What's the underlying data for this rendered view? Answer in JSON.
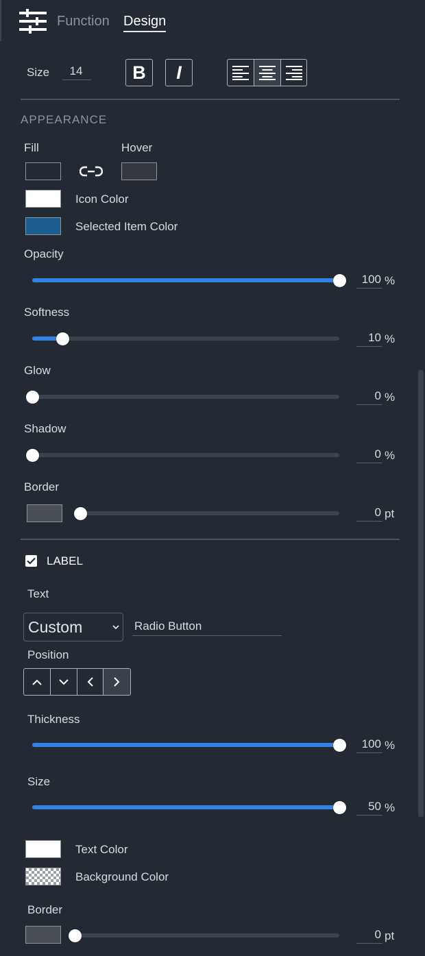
{
  "tabs": {
    "function_label": "Function",
    "design_label": "Design",
    "active": "Design"
  },
  "font_row": {
    "size_label": "Size",
    "size_value": "14",
    "bold_label": "B",
    "italic_label": "I",
    "align_selected": "center"
  },
  "appearance": {
    "title": "APPEARANCE",
    "fill_label": "Fill",
    "hover_label": "Hover",
    "fill_color": "#232a33",
    "hover_color": "#35393f",
    "icon_color_label": "Icon Color",
    "icon_color": "#ffffff",
    "selected_item_color_label": "Selected Item Color",
    "selected_item_color": "#1c5d8f",
    "sliders": [
      {
        "label": "Opacity",
        "value": 100,
        "display": "100",
        "unit": "%"
      },
      {
        "label": "Softness",
        "value": 10,
        "display": "10",
        "unit": "%"
      },
      {
        "label": "Glow",
        "value": 0,
        "display": "0",
        "unit": "%"
      },
      {
        "label": "Shadow",
        "value": 0,
        "display": "0",
        "unit": "%"
      },
      {
        "label": "Border",
        "value": 0,
        "display": "0",
        "unit": "pt",
        "color": "#4a4e55"
      }
    ]
  },
  "label_section": {
    "title": "LABEL",
    "checked": true,
    "text_label": "Text",
    "text_mode": "Custom",
    "text_value": "Radio Button",
    "position_label": "Position",
    "position_selected": "right",
    "sliders": [
      {
        "label": "Thickness",
        "value": 100,
        "display": "100",
        "unit": "%"
      },
      {
        "label": "Size",
        "value": 100,
        "display": "50",
        "unit": "%"
      }
    ],
    "text_color_label": "Text Color",
    "text_color": "#ffffff",
    "background_color_label": "Background Color",
    "background_color": "transparent",
    "border": {
      "label": "Border",
      "value": 0,
      "display": "0",
      "unit": "pt",
      "color": "#4a4e55"
    }
  }
}
